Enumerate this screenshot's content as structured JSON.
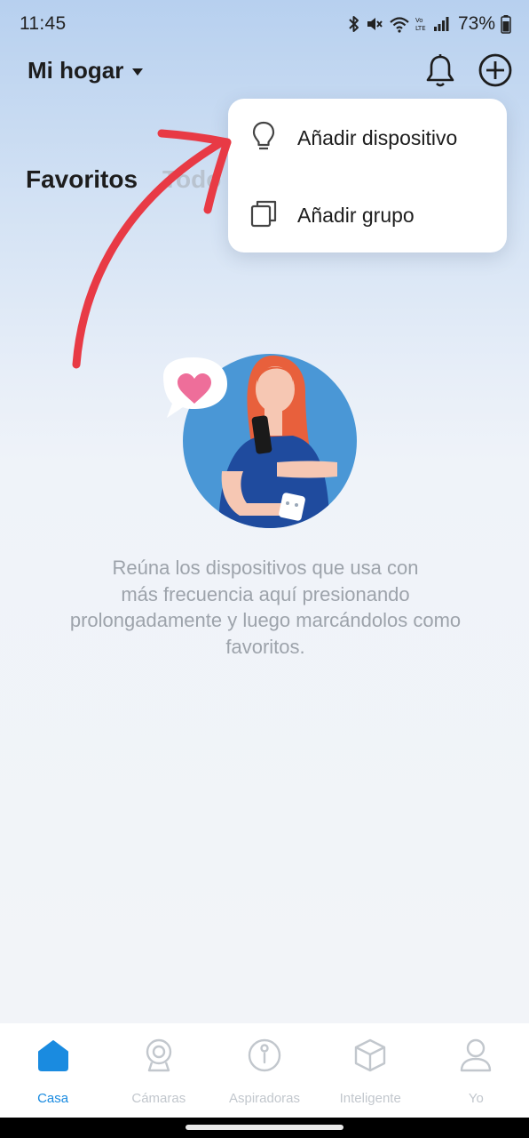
{
  "status_bar": {
    "time": "11:45",
    "battery": "73%",
    "icons": [
      "bluetooth-icon",
      "mute-icon",
      "wifi-icon",
      "volte-icon",
      "signal-icon",
      "battery-icon"
    ]
  },
  "header": {
    "home_name": "Mi hogar",
    "icons": [
      "bell-icon",
      "add-circle-icon"
    ]
  },
  "tabs": {
    "favorites": "Favoritos",
    "all": "Todo"
  },
  "dropdown": {
    "items": [
      {
        "label": "Añadir dispositivo",
        "icon": "lightbulb-icon"
      },
      {
        "label": "Añadir grupo",
        "icon": "copy-group-icon"
      }
    ]
  },
  "empty_state": {
    "line1": "Reúna los dispositivos que usa con",
    "line2": "más frecuencia aquí presionando",
    "line3": "prolongadamente y luego marcándolos como",
    "line4": "favoritos."
  },
  "bottom_nav": {
    "items": [
      {
        "label": "Casa",
        "icon": "home-icon",
        "active": true
      },
      {
        "label": "Cámaras",
        "icon": "camera-icon",
        "active": false
      },
      {
        "label": "Aspiradoras",
        "icon": "robot-vacuum-icon",
        "active": false
      },
      {
        "label": "Inteligente",
        "icon": "cube-icon",
        "active": false
      },
      {
        "label": "Yo",
        "icon": "person-icon",
        "active": false
      }
    ]
  },
  "colors": {
    "accent": "#1a8be0",
    "annotation_arrow": "#e83a45",
    "inactive": "#c2c7cd"
  }
}
